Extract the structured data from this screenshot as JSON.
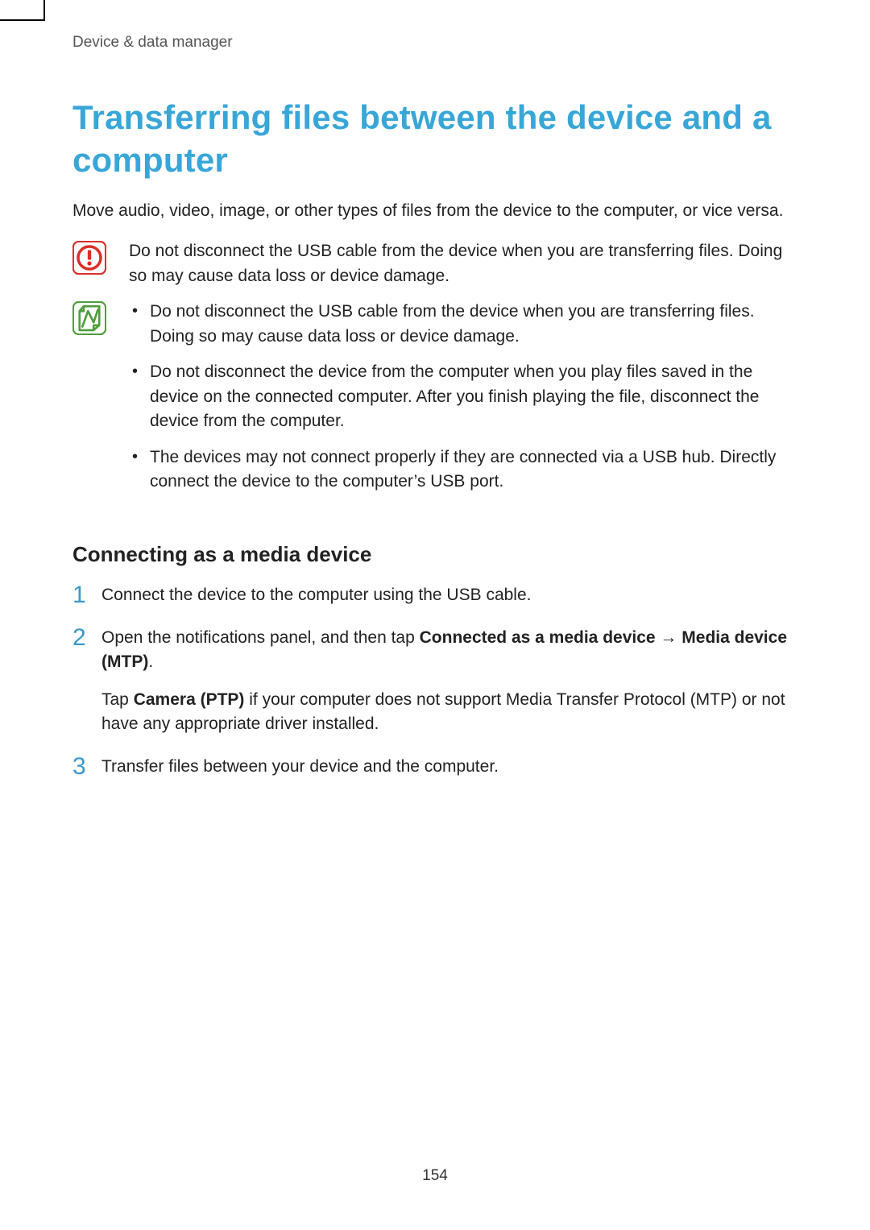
{
  "header": {
    "running_head": "Device & data manager"
  },
  "title": "Transferring files between the device and a computer",
  "intro": "Move audio, video, image, or other types of files from the device to the computer, or vice versa.",
  "caution_text": "Do not disconnect the USB cable from the device when you are transferring files. Doing so may cause data loss or device damage.",
  "note_bullets": [
    "Do not disconnect the USB cable from the device when you are transferring files. Doing so may cause data loss or device damage.",
    "Do not disconnect the device from the computer when you play files saved in the device on the connected computer. After you finish playing the file, disconnect the device from the computer.",
    "The devices may not connect properly if they are connected via a USB hub. Directly connect the device to the computer’s USB port."
  ],
  "section_head": "Connecting as a media device",
  "steps": {
    "s1": {
      "num": "1",
      "text": "Connect the device to the computer using the USB cable."
    },
    "s2": {
      "num": "2",
      "prefix": "Open the notifications panel, and then tap ",
      "bold1": "Connected as a media device",
      "arrow": " → ",
      "bold2": "Media device (MTP)",
      "period": ".",
      "extra_prefix": "Tap ",
      "extra_bold": "Camera (PTP)",
      "extra_suffix": " if your computer does not support Media Transfer Protocol (MTP) or not have any appropriate driver installed."
    },
    "s3": {
      "num": "3",
      "text": "Transfer files between your device and the computer."
    }
  },
  "page_number": "154"
}
